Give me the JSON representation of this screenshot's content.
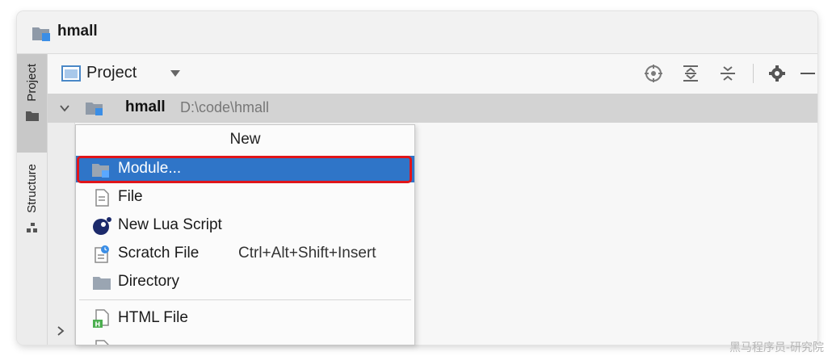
{
  "window": {
    "title": "hmall"
  },
  "sidebar": {
    "tabs": [
      {
        "label": "Project",
        "active": true
      },
      {
        "label": "Structure",
        "active": false
      }
    ]
  },
  "toolbar": {
    "view_label": "Project",
    "icons": [
      "locate-icon",
      "expand-all-icon",
      "collapse-all-icon",
      "settings-icon",
      "hide-icon"
    ]
  },
  "tree": {
    "root_name": "hmall",
    "root_path": "D:\\code\\hmall"
  },
  "context_menu": {
    "header": "New",
    "items": [
      {
        "label": "Module...",
        "icon": "module-folder-icon",
        "selected": true
      },
      {
        "label": "File",
        "icon": "file-icon"
      },
      {
        "label": "New Lua Script",
        "icon": "lua-icon"
      },
      {
        "label": "Scratch File",
        "icon": "scratch-file-icon",
        "shortcut": "Ctrl+Alt+Shift+Insert"
      },
      {
        "label": "Directory",
        "icon": "directory-icon"
      },
      {
        "label": "HTML File",
        "icon": "html-file-icon"
      }
    ]
  },
  "watermark": "黑马程序员-研究院",
  "colors": {
    "selection": "#2f75c8",
    "highlight_border": "#e0151a"
  }
}
